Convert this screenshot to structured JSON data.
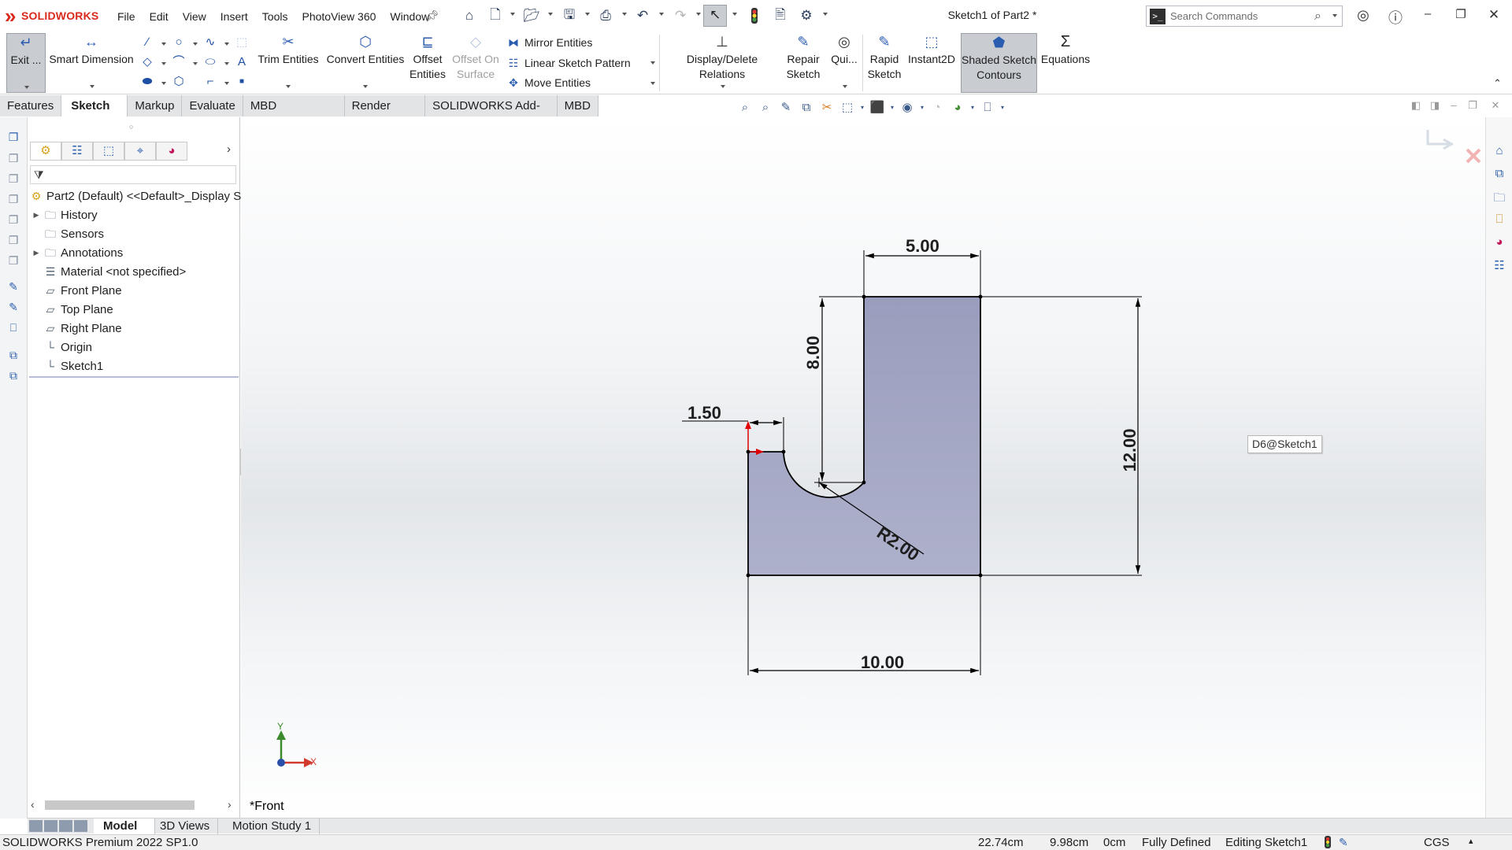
{
  "app": {
    "brand": "SOLIDWORKS",
    "document_title": "Sketch1 of Part2 *"
  },
  "menu": [
    "File",
    "Edit",
    "View",
    "Insert",
    "Tools",
    "PhotoView 360",
    "Window"
  ],
  "search": {
    "placeholder": "Search Commands"
  },
  "command_manager": {
    "exit": "Exit ...",
    "smart_dimension": "Smart Dimension",
    "trim": "Trim Entities",
    "convert": "Convert Entities",
    "offset_1": "Offset",
    "offset_2": "Entities",
    "offset_surface_1": "Offset On",
    "offset_surface_2": "Surface",
    "mirror": "Mirror Entities",
    "linear_pattern": "Linear Sketch Pattern",
    "move": "Move Entities",
    "display_relations": "Display/Delete Relations",
    "repair_1": "Repair",
    "repair_2": "Sketch",
    "quick": "Qui...",
    "rapid_1": "Rapid",
    "rapid_2": "Sketch",
    "instant2d": "Instant2D",
    "shaded_1": "Shaded Sketch",
    "shaded_2": "Contours",
    "equations": "Equations"
  },
  "tabs": [
    "Features",
    "Sketch",
    "Markup",
    "Evaluate",
    "MBD Dimensions",
    "Render Tools",
    "SOLIDWORKS Add-Ins",
    "MBD"
  ],
  "active_tab": "Sketch",
  "feature_tree": {
    "root": "Part2 (Default) <<Default>_Display S",
    "items": [
      {
        "label": "History",
        "expandable": true,
        "icon": "history-folder-icon"
      },
      {
        "label": "Sensors",
        "expandable": false,
        "icon": "sensors-folder-icon"
      },
      {
        "label": "Annotations",
        "expandable": true,
        "icon": "annotations-folder-icon"
      },
      {
        "label": "Material <not specified>",
        "expandable": false,
        "icon": "material-icon"
      },
      {
        "label": "Front Plane",
        "expandable": false,
        "icon": "plane-icon"
      },
      {
        "label": "Top Plane",
        "expandable": false,
        "icon": "plane-icon"
      },
      {
        "label": "Right Plane",
        "expandable": false,
        "icon": "plane-icon"
      },
      {
        "label": "Origin",
        "expandable": false,
        "icon": "origin-icon"
      },
      {
        "label": "Sketch1",
        "expandable": false,
        "icon": "sketch-icon"
      }
    ]
  },
  "sketch": {
    "dims": {
      "top_width": "5.00",
      "slot_depth": "8.00",
      "offset": "1.50",
      "height": "12.00",
      "radius": "R2.00",
      "width": "10.00"
    },
    "tooltip": "D6@Sketch1",
    "triad_x": "X",
    "triad_y": "Y"
  },
  "view_label": "*Front",
  "bottom_tabs": [
    "Model",
    "3D Views",
    "Motion Study 1"
  ],
  "status": {
    "product": "SOLIDWORKS Premium 2022 SP1.0",
    "x": "22.74cm",
    "y": "9.98cm",
    "z": "0cm",
    "state": "Fully Defined",
    "mode": "Editing Sketch1",
    "units": "CGS"
  },
  "colors": {
    "brand_red": "#da291c",
    "sketch_fill": "#a6a9c6",
    "active_button": "#c9cdd2",
    "dimension_arrow_red": "#e00000"
  }
}
